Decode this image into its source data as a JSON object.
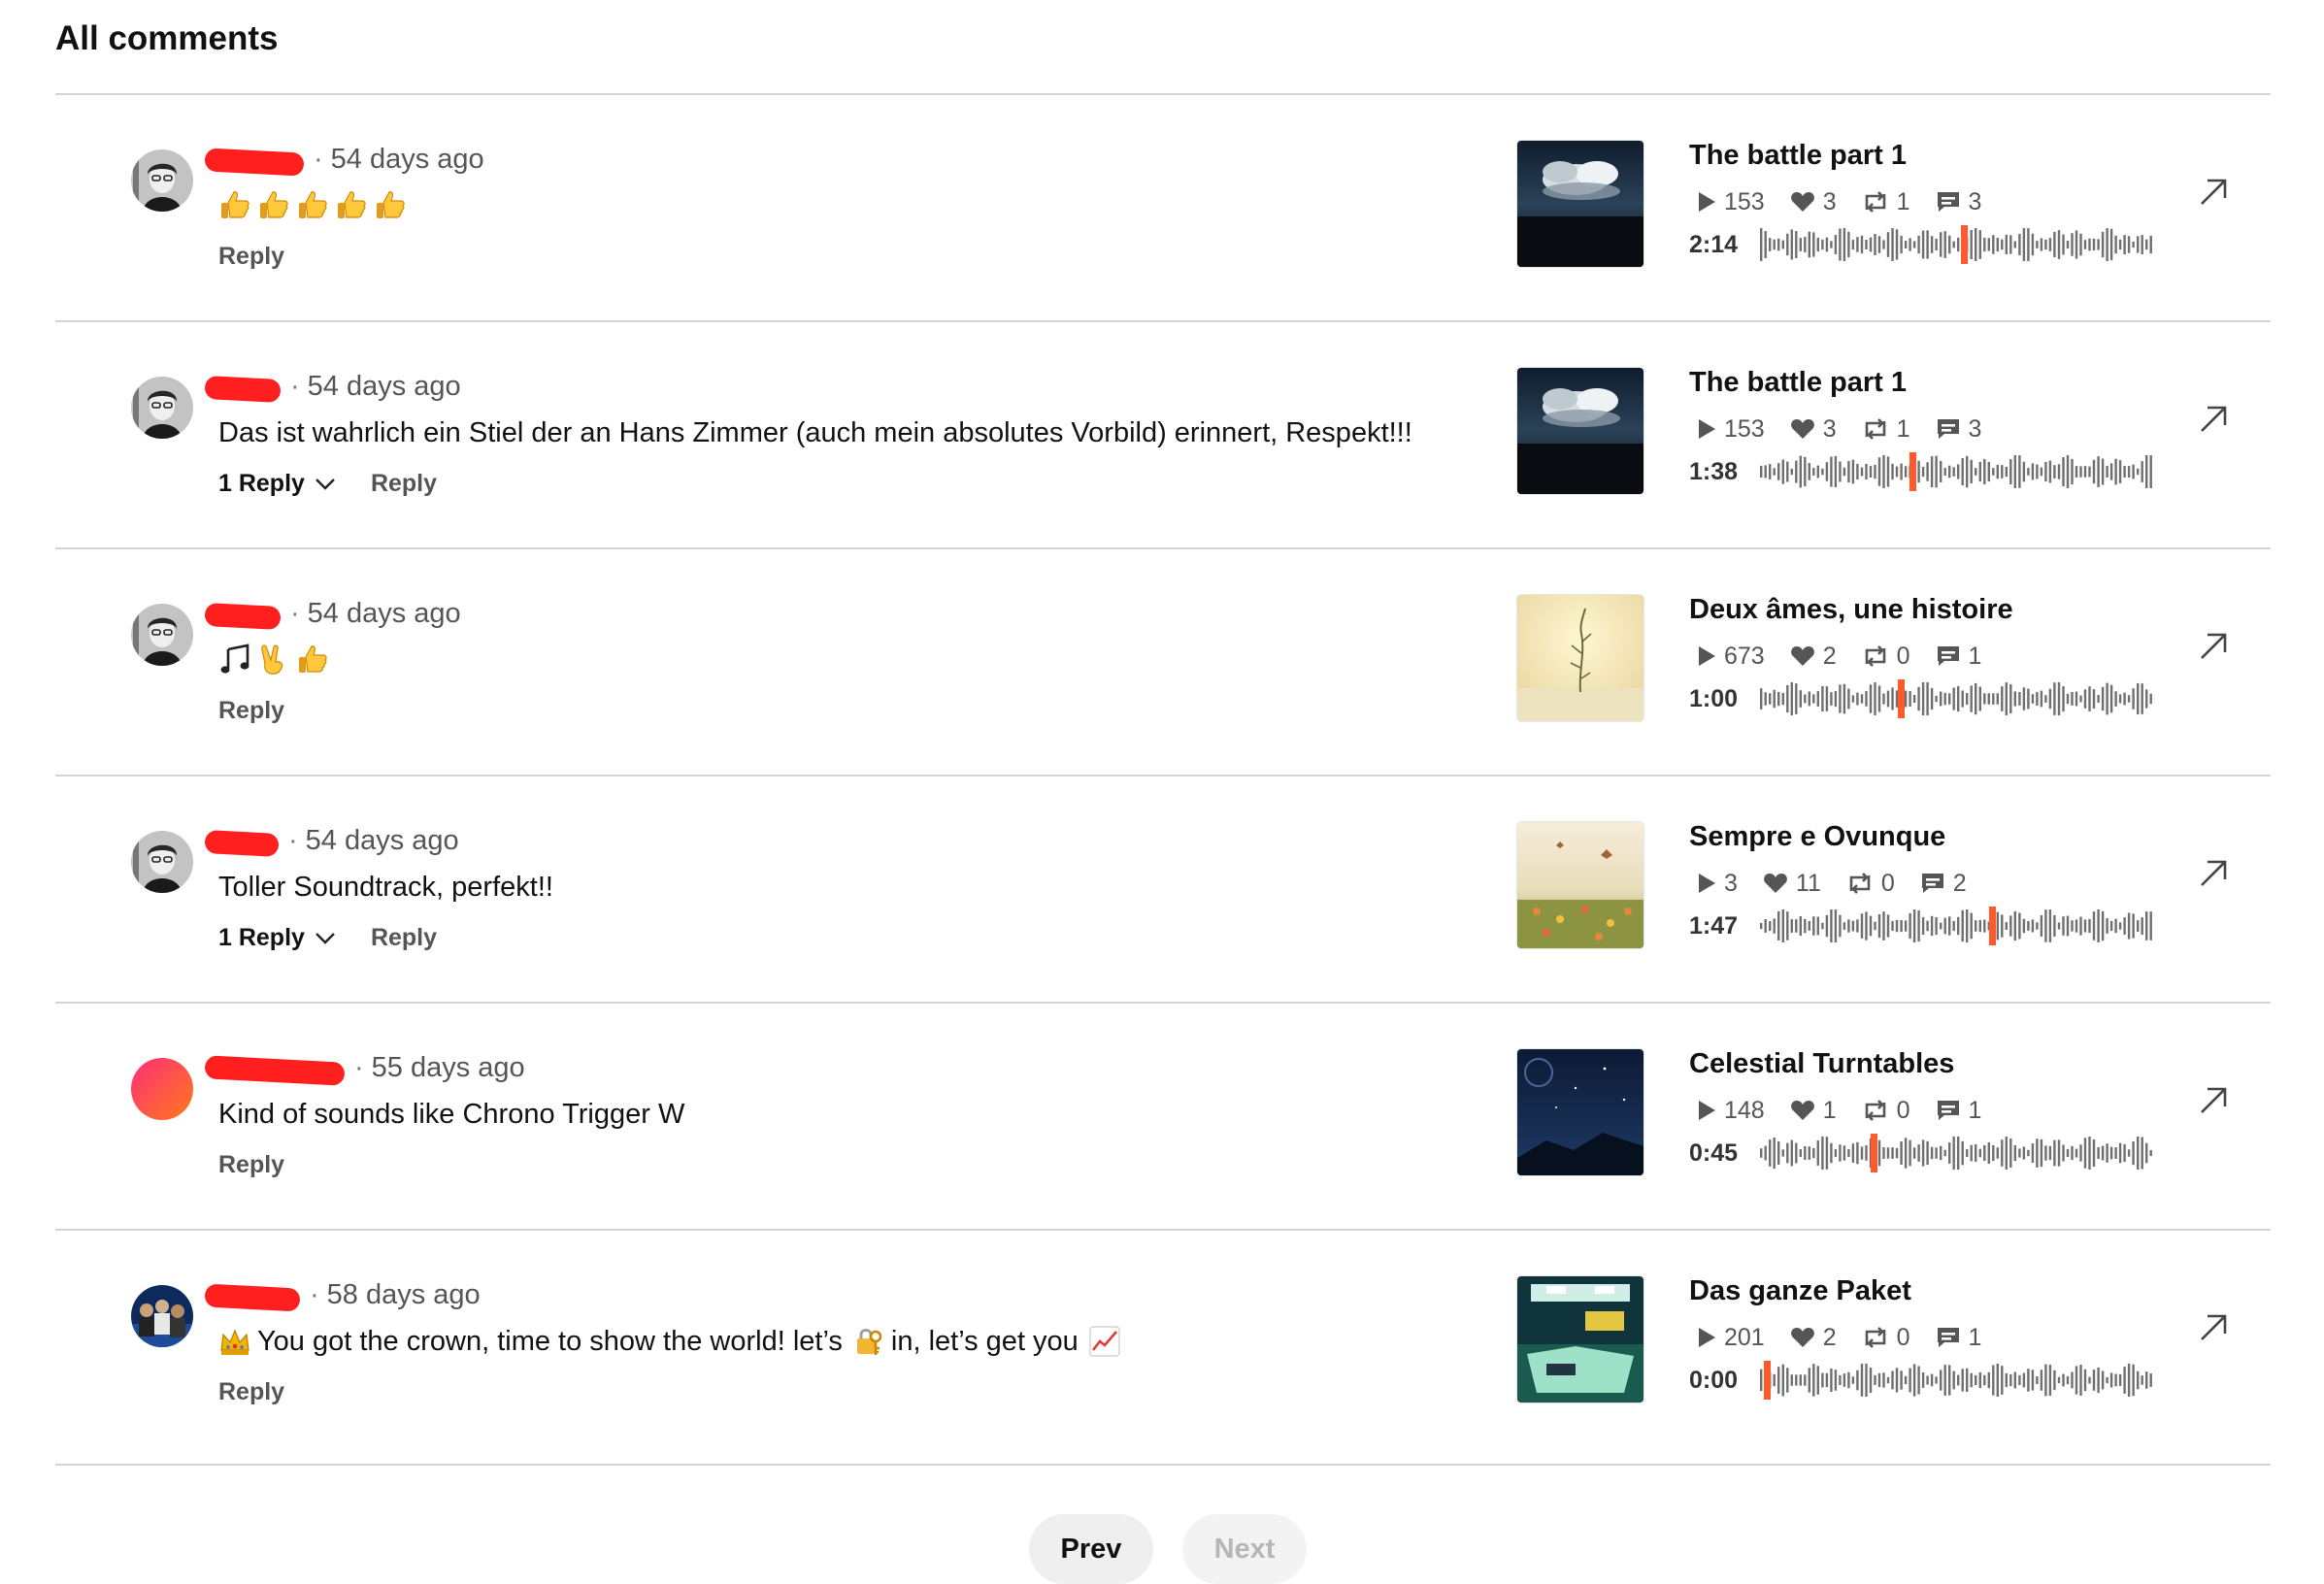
{
  "heading": "All comments",
  "colors": {
    "redaction": "#ff1f1f",
    "playhead": "#ff5a2c",
    "wave": "#6f6f6f",
    "divider": "#d4d4d4"
  },
  "comments": [
    {
      "time_ago": "54 days ago",
      "text": "",
      "emojis": [
        "thumbs-up",
        "thumbs-up",
        "thumbs-up",
        "thumbs-up",
        "thumbs-up"
      ],
      "replies_label": "",
      "reply_label": "Reply",
      "avatar": "portrait-avatar",
      "track": {
        "title": "The battle part 1",
        "plays": "153",
        "likes": "3",
        "reposts": "1",
        "comments": "3",
        "time": "2:14",
        "progress": 0.52,
        "art": "cloud-sky"
      }
    },
    {
      "time_ago": "54 days ago",
      "text": "Das ist wahrlich ein Stiel der an Hans Zimmer (auch mein absolutes Vorbild) erinnert, Respekt!!!",
      "emojis": [],
      "replies_label": "1 Reply",
      "reply_label": "Reply",
      "avatar": "portrait-avatar",
      "track": {
        "title": "The battle part 1",
        "plays": "153",
        "likes": "3",
        "reposts": "1",
        "comments": "3",
        "time": "1:38",
        "progress": 0.39,
        "art": "cloud-sky"
      }
    },
    {
      "time_ago": "54 days ago",
      "text": "",
      "emojis": [
        "music-notes",
        "victory-hand",
        "thumbs-up"
      ],
      "replies_label": "",
      "reply_label": "Reply",
      "avatar": "portrait-avatar",
      "track": {
        "title": "Deux âmes, une histoire",
        "plays": "673",
        "likes": "2",
        "reposts": "0",
        "comments": "1",
        "time": "1:00",
        "progress": 0.36,
        "art": "plant-light"
      }
    },
    {
      "time_ago": "54 days ago",
      "text": "Toller Soundtrack, perfekt!!",
      "emojis": [],
      "replies_label": "1 Reply",
      "reply_label": "Reply",
      "avatar": "portrait-avatar",
      "track": {
        "title": "Sempre e Ovunque",
        "plays": "3",
        "likes": "11",
        "reposts": "0",
        "comments": "2",
        "time": "1:47",
        "progress": 0.59,
        "art": "flower-field"
      }
    },
    {
      "time_ago": "55 days ago",
      "text": "Kind of sounds like Chrono Trigger W",
      "emojis": [],
      "replies_label": "",
      "reply_label": "Reply",
      "avatar": "gradient-avatar",
      "track": {
        "title": "Celestial Turntables",
        "plays": "148",
        "likes": "1",
        "reposts": "0",
        "comments": "1",
        "time": "0:45",
        "progress": 0.29,
        "art": "night-sky"
      }
    },
    {
      "time_ago": "58 days ago",
      "text": "",
      "rich_text": [
        "You got the crown, time to show the world! let’s",
        "in, let’s get you"
      ],
      "emojis": [
        "crown",
        "lock-with-key",
        "chart-increasing"
      ],
      "replies_label": "",
      "reply_label": "Reply",
      "avatar": "group-avatar",
      "track": {
        "title": "Das ganze Paket",
        "plays": "201",
        "likes": "2",
        "reposts": "0",
        "comments": "1",
        "time": "0:00",
        "progress": 0.02,
        "art": "studio-room"
      }
    }
  ],
  "pagination": {
    "prev": "Prev",
    "next": "Next"
  }
}
